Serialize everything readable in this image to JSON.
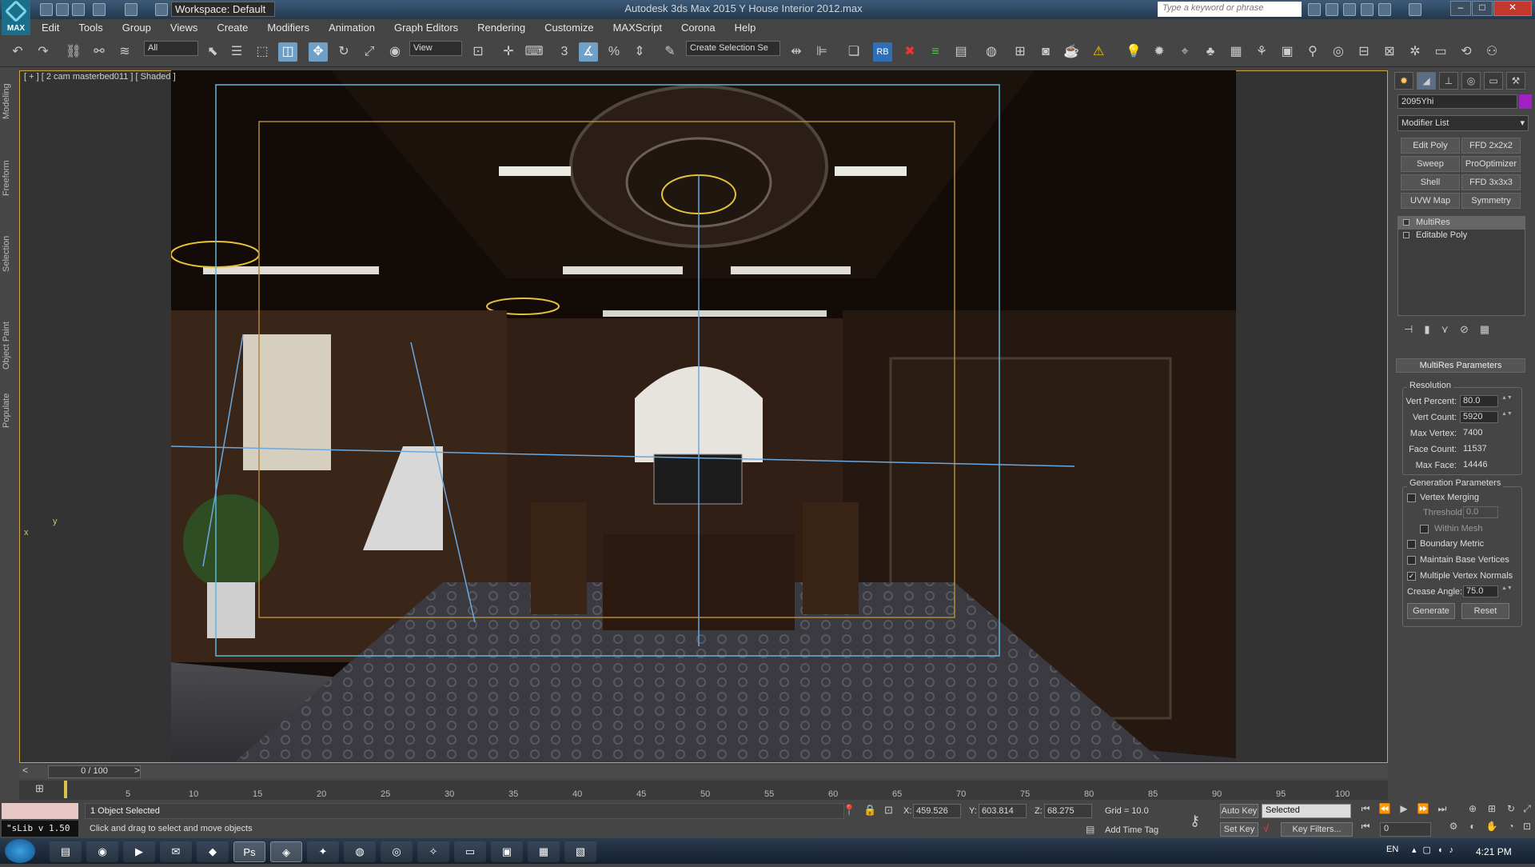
{
  "titlebar": {
    "workspace": "Workspace: Default",
    "app_title": "Autodesk 3ds Max 2015    Y House Interior 2012.max",
    "search_placeholder": "Type a keyword or phrase",
    "logo_text": "MAX"
  },
  "menubar": [
    "Edit",
    "Tools",
    "Group",
    "Views",
    "Create",
    "Modifiers",
    "Animation",
    "Graph Editors",
    "Rendering",
    "Customize",
    "MAXScript",
    "Corona",
    "Help"
  ],
  "toolbar": {
    "selection_filter": "All",
    "ref_coord": "View",
    "named_selection": "Create Selection Se",
    "rb_label": "RB",
    "snap_label": "3"
  },
  "left_tabs": [
    "Modeling",
    "Freeform",
    "Selection",
    "Object Paint",
    "Populate"
  ],
  "viewport": {
    "label": "[ + ] [ 2 cam masterbed011 ] [ Shaded ]",
    "axis_y": "y",
    "axis_x": "x"
  },
  "command_panel": {
    "object_name": "2095Yhi",
    "object_color": "#a020c0",
    "modifier_list": "Modifier List",
    "modifier_buttons": [
      "Edit Poly",
      "FFD 2x2x2",
      "Sweep",
      "ProOptimizer",
      "Shell",
      "FFD 3x3x3",
      "UVW Map",
      "Symmetry"
    ],
    "stack": [
      "MultiRes",
      "Editable Poly"
    ],
    "rollout_title": "MultiRes Parameters",
    "resolution_group": "Resolution",
    "params": [
      {
        "label": "Vert Percent:",
        "value": "80.0",
        "editable": true
      },
      {
        "label": "Vert Count:",
        "value": "5920",
        "editable": true
      },
      {
        "label": "Max Vertex:",
        "value": "7400",
        "editable": false
      },
      {
        "label": "Face Count:",
        "value": "11537",
        "editable": false
      },
      {
        "label": "Max Face:",
        "value": "14446",
        "editable": false
      }
    ],
    "generation_group": "Generation Parameters",
    "vertex_merging": "Vertex Merging",
    "threshold_label": "Threshold:",
    "threshold_value": "0.0",
    "within_mesh": "Within Mesh",
    "boundary_metric": "Boundary Metric",
    "maintain_base": "Maintain Base Vertices",
    "multiple_normals": "Multiple Vertex Normals",
    "crease_label": "Crease Angle:",
    "crease_value": "75.0",
    "generate": "Generate",
    "reset": "Reset",
    "checkmark": "✓"
  },
  "timeline": {
    "frame_indicator": "0 / 100",
    "ticks": [
      "5",
      "10",
      "15",
      "20",
      "25",
      "30",
      "35",
      "40",
      "45",
      "50",
      "55",
      "60",
      "65",
      "70",
      "75",
      "80",
      "85",
      "90",
      "95",
      "100"
    ]
  },
  "status": {
    "selection": "1 Object Selected",
    "prompt": "Click and drag to select and move objects",
    "maxscript_version": "\"sLib v 1.50",
    "x_label": "X:",
    "x_value": "459.526",
    "y_label": "Y:",
    "y_value": "603.814",
    "z_label": "Z:",
    "z_value": "68.275",
    "grid": "Grid = 10.0",
    "add_time_tag": "Add Time Tag",
    "auto_key": "Auto Key",
    "set_key": "Set Key",
    "key_mode": "Selected",
    "key_filters": "Key Filters...",
    "frame": "0"
  },
  "taskbar": {
    "lang": "EN",
    "clock": "4:21 PM"
  }
}
